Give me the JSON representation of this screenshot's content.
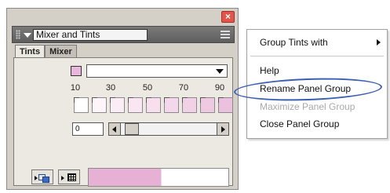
{
  "panel": {
    "title": "Mixer and Tints",
    "close_glyph": "×",
    "tabs": [
      {
        "label": "Tints",
        "active": true
      },
      {
        "label": "Mixer",
        "active": false
      }
    ],
    "tint_ticks": [
      "10",
      "30",
      "50",
      "70",
      "90"
    ],
    "tint_input_value": "0",
    "base_swatch_color": "#e9b6dc",
    "icons": {
      "grip": "grip-icon",
      "collapse": "collapse-arrow-icon",
      "options": "options-menu-icon",
      "new_tint": "new-tint-icon",
      "tint_grid": "tint-grid-icon"
    }
  },
  "context_menu": {
    "items": [
      {
        "label": "Group Tints with",
        "disabled": false,
        "has_submenu": true
      },
      {
        "label": "Help",
        "disabled": false
      },
      {
        "label": "Rename Panel Group",
        "disabled": false,
        "circled": true
      },
      {
        "label": "Maximize Panel Group",
        "disabled": true
      },
      {
        "label": "Close Panel Group",
        "disabled": false
      }
    ],
    "circle_color": "#3b5fb3"
  }
}
